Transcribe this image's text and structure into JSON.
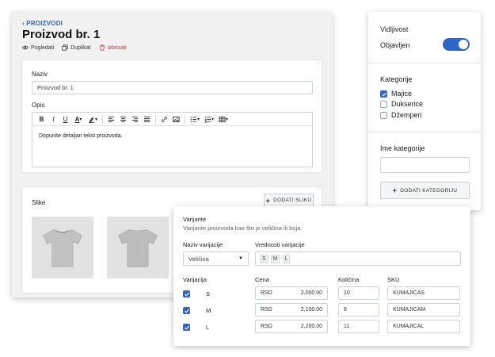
{
  "product": {
    "back_link": "‹ PROIZVODI",
    "title": "Proizvod br. 1",
    "actions": {
      "view": "Pogledati",
      "duplicate": "Duplikat",
      "delete": "Izbrisati"
    }
  },
  "form": {
    "name_label": "Naziv",
    "name_value": "Proizvod br. 1",
    "description_label": "Opis",
    "description_text": "Dopunite detaljan tekst proizvoda.",
    "images_label": "Slike",
    "add_image_button": "DODATI SLIKU"
  },
  "sidebar": {
    "visibility_label": "Vidljivost",
    "published_label": "Objavljen",
    "published": true,
    "categories_label": "Kategorije",
    "categories": [
      {
        "label": "Majice",
        "checked": true
      },
      {
        "label": "Dukserice",
        "checked": false
      },
      {
        "label": "Džemperi",
        "checked": false
      }
    ],
    "category_name_label": "Ime kategorije",
    "add_category_button": "DODATI KATEGORIJU"
  },
  "variants": {
    "title": "Varijante",
    "subtitle": "Varijante proizvoda kao što je veličina ili boja.",
    "name_label": "Naziv varijacije",
    "name_value": "Veličina",
    "values_label": "Vrednosti varijacije",
    "values": [
      "S",
      "M",
      "L"
    ],
    "columns": {
      "variant": "Varijacija",
      "price": "Cena",
      "quantity": "Količina",
      "sku": "SKU"
    },
    "rows": [
      {
        "size": "S",
        "currency": "RSD",
        "price": "2,000.00",
        "quantity": "10",
        "sku": "KUMAJICAS",
        "checked": true
      },
      {
        "size": "M",
        "currency": "RSD",
        "price": "2,100.00",
        "quantity": "8",
        "sku": "KUMAJICAM",
        "checked": true
      },
      {
        "size": "L",
        "currency": "RSD",
        "price": "2,200.00",
        "quantity": "11",
        "sku": "KUMAJICAL",
        "checked": true
      }
    ]
  },
  "colors": {
    "accent": "#2f64c9",
    "danger": "#d33a3a"
  }
}
